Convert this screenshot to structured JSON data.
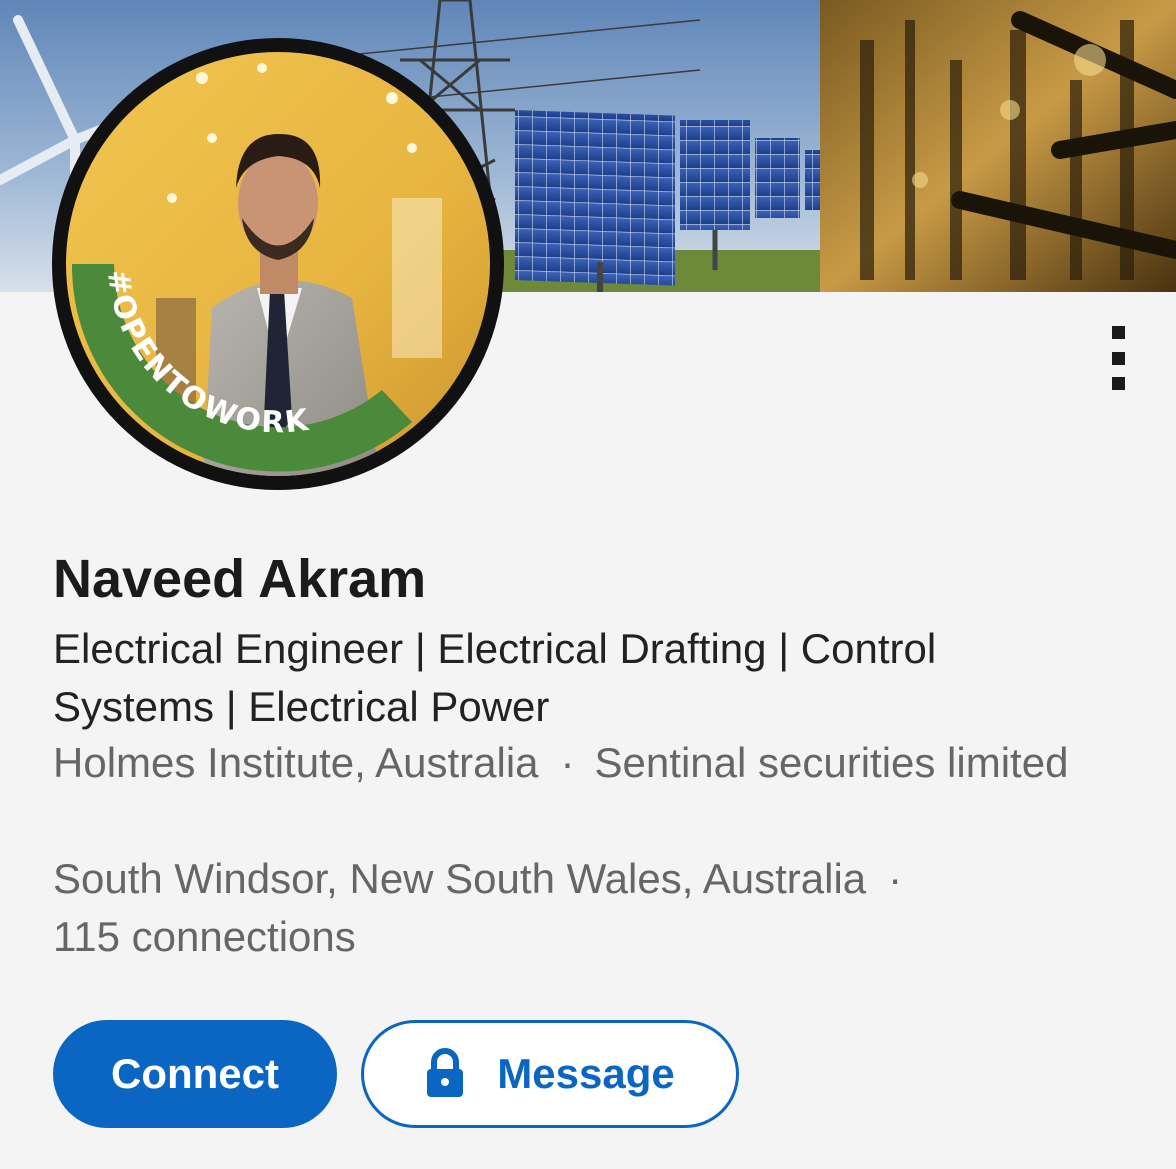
{
  "profile": {
    "name": "Naveed Akram",
    "headline": "Electrical Engineer | Electrical Drafting | Control Systems | Electrical Power",
    "work_line_1": "Holmes Institute, Australia",
    "work_line_2": "Sentinal securities limited",
    "location": "South Windsor, New South Wales, Australia",
    "connections": "115 connections",
    "separator": "·"
  },
  "badge": {
    "frame_text": "#OPENTOWORK",
    "frame_color": "#4a8a3a"
  },
  "actions": {
    "connect_label": "Connect",
    "message_label": "Message",
    "more_icon": "more-vertical-icon",
    "lock_icon": "lock-icon"
  },
  "colors": {
    "primary": "#0a66c2",
    "text": "#1b1b1b",
    "muted": "#666666"
  }
}
